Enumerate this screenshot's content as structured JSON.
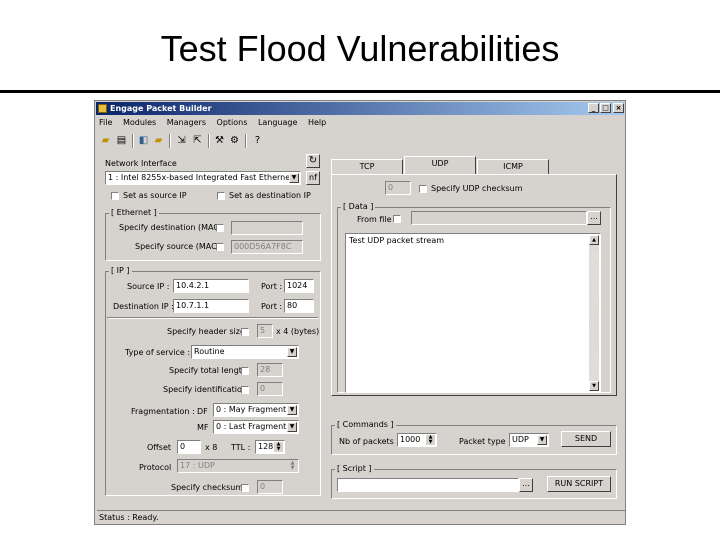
{
  "slide": {
    "title": "Test Flood Vulnerabilities"
  },
  "window": {
    "title": "Engage Packet Builder",
    "controls": {
      "minimize": "_",
      "maximize": "□",
      "close": "×"
    }
  },
  "menu": [
    "File",
    "Modules",
    "Managers",
    "Options",
    "Language",
    "Help"
  ],
  "left": {
    "network_interface_label": "Network Interface",
    "network_interface_value": "1 : Intel 8255x-based Integrated Fast Ethernet",
    "set_source_ip": "Set as source IP",
    "set_dest_ip": "Set as destination IP",
    "ethernet": {
      "group": "[ Ethernet ]",
      "specify_dest_mac": "Specify destination (MAC)",
      "specify_source_mac": "Specify source (MAC)",
      "source_mac_value": "000D56A7F8C"
    },
    "ip": {
      "group": "[ IP ]",
      "source_ip_label": "Source IP :",
      "source_ip": "10.4.2.1",
      "port_label_1": "Port :",
      "source_port": "1024",
      "dest_ip_label": "Destination IP :",
      "dest_ip": "10.7.1.1",
      "port_label_2": "Port :",
      "dest_port": "80",
      "header_size_label": "Specify header size",
      "header_size_value": "5",
      "header_size_unit": "x 4 (bytes)",
      "tos_label": "Type of service :",
      "tos_value": "Routine",
      "total_length_label": "Specify total length",
      "total_length_value": "28",
      "identification_label": "Specify identification",
      "identification_value": "0",
      "fragmentation_label": "Fragmentation :",
      "df_label": "DF",
      "df_value": "0 : May Fragment",
      "mf_label": "MF",
      "mf_value": "0 : Last Fragment",
      "offset_label": "Offset",
      "offset_value": "0",
      "offset_unit": "x 8",
      "ttl_label": "TTL :",
      "ttl_value": "128",
      "protocol_label": "Protocol",
      "protocol_value": "17 : UDP",
      "checksum_label": "Specify checksum",
      "checksum_value": "0"
    }
  },
  "right": {
    "tabs": [
      "TCP",
      "UDP",
      "ICMP"
    ],
    "udp_checksum_value": "0",
    "udp_checksum_label": "Specify UDP checksum",
    "data_group": "[ Data ]",
    "from_file_label": "From file",
    "browse_label": "...",
    "data_text": "Test UDP packet stream",
    "commands_group": "[ Commands ]",
    "nb_packets_label": "Nb of packets",
    "nb_packets_value": "1000",
    "packet_type_label": "Packet type",
    "packet_type_value": "UDP",
    "send_label": "SEND",
    "script_group": "[ Script ]",
    "script_browse": "...",
    "run_script_label": "RUN SCRIPT"
  },
  "status": {
    "label": "Status :",
    "text": "Ready."
  }
}
